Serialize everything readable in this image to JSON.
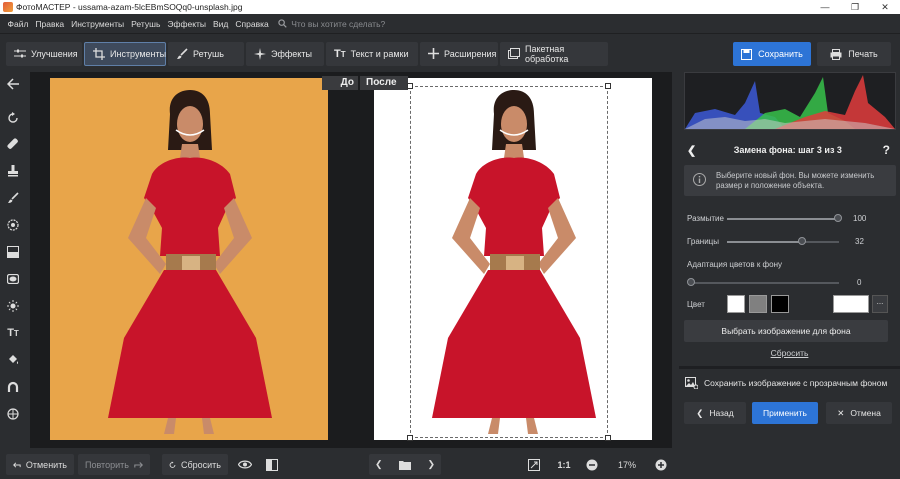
{
  "window": {
    "title": "ФотоМАСТЕР - ussama-azam-5lcEBmSOQq0-unsplash.jpg"
  },
  "menu": {
    "items": [
      "Файл",
      "Правка",
      "Инструменты",
      "Ретушь",
      "Эффекты",
      "Вид",
      "Справка"
    ],
    "search_placeholder": "Что вы хотите сделать?"
  },
  "toolbar": {
    "tabs": [
      {
        "label": "Улучшения",
        "icon": "sliders-icon"
      },
      {
        "label": "Инструменты",
        "icon": "crop-icon",
        "active": true
      },
      {
        "label": "Ретушь",
        "icon": "brush-icon"
      },
      {
        "label": "Эффекты",
        "icon": "sparkle-icon"
      },
      {
        "label": "Текст и рамки",
        "icon": "text-icon"
      },
      {
        "label": "Расширения",
        "icon": "plus-icon"
      },
      {
        "label": "Пакетная обработка",
        "icon": "batch-icon"
      }
    ],
    "save_label": "Сохранить",
    "print_label": "Печать"
  },
  "canvas": {
    "before_label": "До",
    "after_label": "После",
    "background_color": "#e8a54a"
  },
  "bottom": {
    "undo_label": "Отменить",
    "redo_label": "Повторить",
    "reset_label": "Сбросить",
    "ratio_label": "1:1",
    "zoom_value": "17%"
  },
  "panel": {
    "title": "Замена фона: шаг 3 из 3",
    "help": "?",
    "info_text": "Выберите новый фон. Вы можете изменить размер и положение объекта.",
    "sliders": [
      {
        "label": "Размытие",
        "value": "100",
        "level": 1.0
      },
      {
        "label": "Границы",
        "value": "32",
        "level": 0.57
      },
      {
        "label": "Адаптация цветов к фону",
        "value": "0",
        "level": 0.0
      }
    ],
    "color_label": "Цвет",
    "swatches": [
      "#ffffff",
      "#808080",
      "#000000"
    ],
    "current_color": "#ffffff",
    "more_label": "...",
    "choose_image_label": "Выбрать изображение для фона",
    "reset_link": "Сбросить",
    "save_transparent_label": "Сохранить изображение с прозрачным фоном",
    "back_label": "Назад",
    "apply_label": "Применить",
    "cancel_label": "Отмена"
  },
  "colors": {
    "accent": "#2d74d6",
    "bg": "#2b2d30"
  }
}
